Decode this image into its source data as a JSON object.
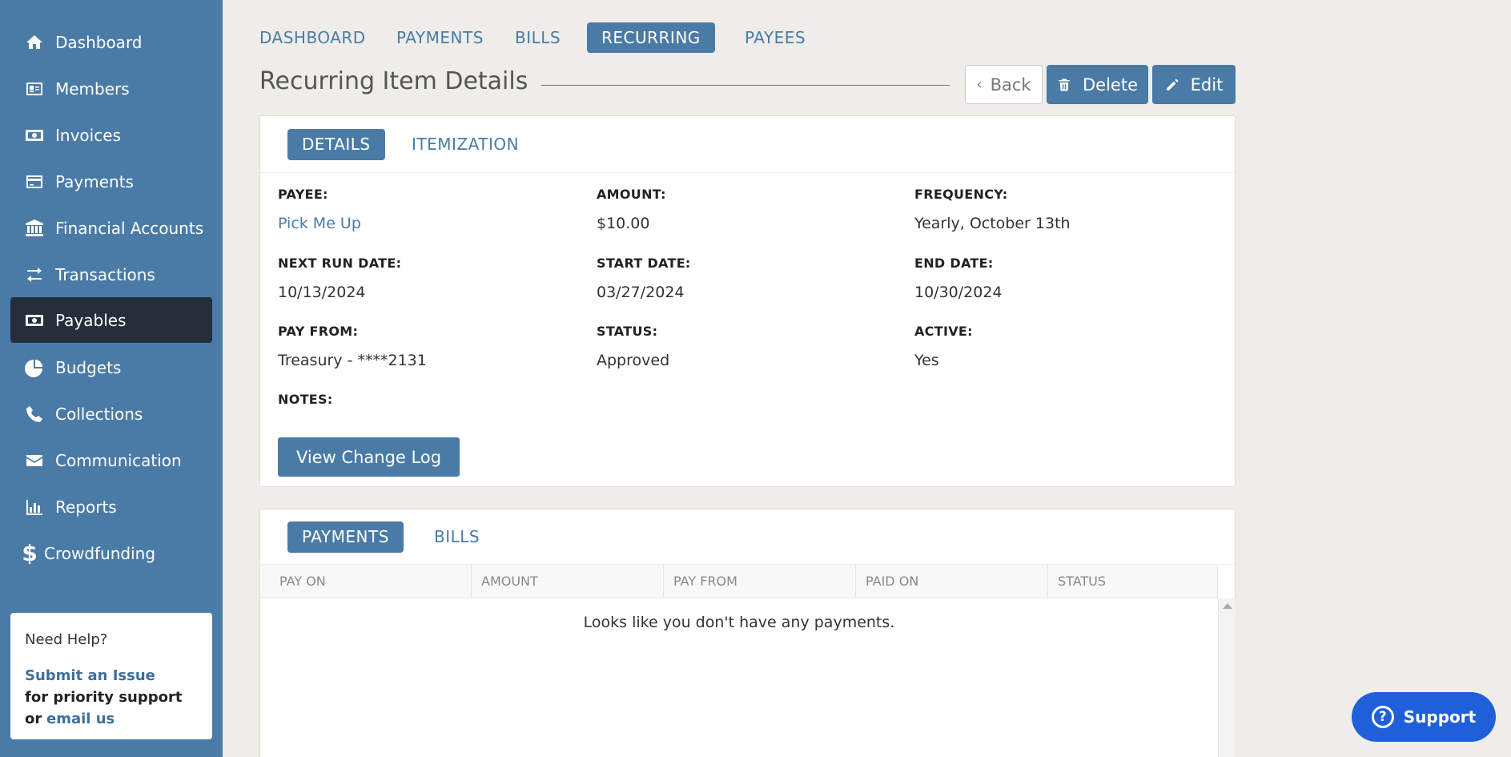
{
  "sidebar": {
    "items": [
      {
        "label": "Dashboard",
        "icon": "home-icon"
      },
      {
        "label": "Members",
        "icon": "member-card-icon"
      },
      {
        "label": "Invoices",
        "icon": "money-icon"
      },
      {
        "label": "Payments",
        "icon": "credit-card-icon"
      },
      {
        "label": "Financial Accounts",
        "icon": "bank-icon"
      },
      {
        "label": "Transactions",
        "icon": "exchange-icon"
      },
      {
        "label": "Payables",
        "icon": "money-icon",
        "active": true
      },
      {
        "label": "Budgets",
        "icon": "pie-chart-icon"
      },
      {
        "label": "Collections",
        "icon": "phone-icon"
      },
      {
        "label": "Communication",
        "icon": "envelope-icon"
      },
      {
        "label": "Reports",
        "icon": "bar-chart-icon"
      },
      {
        "label": "Crowdfunding",
        "icon": "dollar-icon"
      }
    ],
    "help": {
      "title": "Need Help?",
      "submit_link": "Submit an Issue",
      "priority_text": "for priority support",
      "or_text": "or",
      "email_link": "email us"
    }
  },
  "top_tabs": [
    {
      "label": "DASHBOARD"
    },
    {
      "label": "PAYMENTS"
    },
    {
      "label": "BILLS"
    },
    {
      "label": "RECURRING",
      "active": true
    },
    {
      "label": "PAYEES"
    }
  ],
  "header": {
    "title": "Recurring Item Details",
    "back_label": "Back",
    "delete_label": "Delete",
    "edit_label": "Edit"
  },
  "details_card": {
    "tabs": [
      "DETAILS",
      "ITEMIZATION"
    ],
    "fields": {
      "payee": {
        "label": "PAYEE:",
        "value": "Pick Me Up"
      },
      "amount": {
        "label": "AMOUNT:",
        "value": "$10.00"
      },
      "frequency": {
        "label": "FREQUENCY:",
        "value": "Yearly, October 13th"
      },
      "next_run": {
        "label": "NEXT RUN DATE:",
        "value": "10/13/2024"
      },
      "start": {
        "label": "START DATE:",
        "value": "03/27/2024"
      },
      "end": {
        "label": "END DATE:",
        "value": "10/30/2024"
      },
      "pay_from": {
        "label": "PAY FROM:",
        "value": "Treasury - ****2131"
      },
      "status": {
        "label": "STATUS:",
        "value": "Approved"
      },
      "active": {
        "label": "ACTIVE:",
        "value": "Yes"
      },
      "notes": {
        "label": "NOTES:"
      }
    },
    "change_log_label": "View Change Log"
  },
  "payments_card": {
    "tabs": [
      "PAYMENTS",
      "BILLS"
    ],
    "columns": [
      "PAY ON",
      "AMOUNT",
      "PAY FROM",
      "PAID ON",
      "STATUS"
    ],
    "empty_message": "Looks like you don't have any payments."
  },
  "support": {
    "label": "Support"
  },
  "colors": {
    "sidebar": "#4a7ba6",
    "active_nav": "#262d3b",
    "support": "#1f5fd9"
  }
}
